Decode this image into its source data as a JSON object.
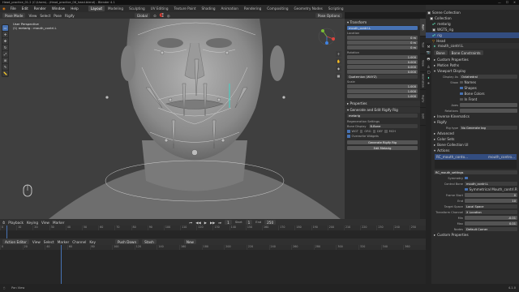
{
  "window": {
    "title": "Head_practice_01.2 (C:\\Users\\...\\Head_practice_06_head.blend) - Blender 4.1"
  },
  "menu": [
    "File",
    "Edit",
    "Render",
    "Window",
    "Help"
  ],
  "workspaces": [
    "Layout",
    "Modeling",
    "Sculpting",
    "UV Editing",
    "Texture Paint",
    "Shading",
    "Animation",
    "Rendering",
    "Compositing",
    "Geometry Nodes",
    "Scripting"
  ],
  "active_workspace": "Layout",
  "scene": {
    "scene_label": "Scene",
    "view_layer": "ViewLayer"
  },
  "header3d": {
    "mode": "Pose Mode",
    "view": "View",
    "select": "Select",
    "pose": "Pose",
    "rigify": "Rigify",
    "orientation": "Global",
    "pose_options": "Pose Options"
  },
  "viewport": {
    "view_name": "User Perspective",
    "object_name": "(1) metarig : mouth_contrl.L"
  },
  "npanel": {
    "transform_title": "Transform",
    "bone_name": "mouth_contrl.L",
    "location_label": "Location",
    "loc": [
      "0 m",
      "0 m",
      "0 m"
    ],
    "rotation_label": "Rotation",
    "rot_mode": "Quaternion (WXYZ)",
    "rot": [
      "1.000",
      "0.000",
      "0.000",
      "0.000"
    ],
    "scale_label": "Scale",
    "scale": [
      "1.000",
      "1.000",
      "1.000"
    ],
    "properties_title": "Properties",
    "gen_title": "Generate and Edit Rigify Rig",
    "metarig_field": "metarig",
    "regen_title": "Regeneration Settings",
    "bone_display": "Bone Display",
    "bone_display_val": "B-Bone",
    "wgt_opts": [
      "WGT",
      "ORG",
      "DEF",
      "MCH"
    ],
    "overwrite_widgets": "Overwrite Widgets",
    "generate_btn": "Generate Rigify Rig",
    "edit_btn": "Edit Metarig"
  },
  "vtabs": [
    "Item",
    "Tool",
    "View",
    "Animation",
    "Rigify",
    "Edit"
  ],
  "outliner": {
    "items": [
      "Scene Collection",
      "Collection",
      "metarig",
      "WGTS_rig",
      "rig",
      "Head"
    ]
  },
  "props": {
    "header": "mouth_contrl.L",
    "tabs": [
      "Bone",
      "Bone Constraints"
    ],
    "rows": [
      {
        "label": "Custom Properties"
      },
      {
        "label": "Motion Paths"
      },
      {
        "label": "Viewport Display"
      },
      {
        "label": "Display As",
        "value": "Octahedral"
      },
      {
        "label": "Show",
        "value": "Names"
      },
      {
        "label": "",
        "value": "Shapes"
      },
      {
        "label": "",
        "value": "Bone Colors"
      },
      {
        "label": "",
        "value": "In Front"
      },
      {
        "label": "Axes",
        "value": ""
      },
      {
        "label": "Relations",
        "value": ""
      },
      {
        "label": "Inverse Kinematics"
      },
      {
        "label": "Rigify"
      },
      {
        "label": "Rig type",
        "value": "No Generate tag"
      },
      {
        "label": "Advanced"
      },
      {
        "label": "Color Sets"
      },
      {
        "label": "Bone Collection UI"
      },
      {
        "label": "Actions"
      }
    ],
    "actions_list": [
      "RC_mouth_conto...",
      "mouth_contro..."
    ],
    "action_row": "RC_mouth_settings",
    "action_fields": [
      {
        "label": "Symmetry",
        "value": ""
      },
      {
        "label": "Control Bone",
        "value": "mouth_contrl.L"
      },
      {
        "label": "",
        "value": "Symmetrical Mouth_contrl.R"
      },
      {
        "label": "Frame Start",
        "value": "0"
      },
      {
        "label": "End",
        "value": "10"
      },
      {
        "label": "Target Space",
        "value": "Local Space"
      },
      {
        "label": "Transform Channel",
        "value": "X Location"
      },
      {
        "label": "Min",
        "value": "-0.01"
      },
      {
        "label": "Max",
        "value": "0.01"
      },
      {
        "label": "Nodes",
        "value": "Default Corner"
      }
    ],
    "footer": "Custom Properties"
  },
  "timeline": {
    "playback": "Playback",
    "keying": "Keying",
    "view": "View",
    "marker": "Marker",
    "frame": "1",
    "start_label": "Start",
    "start": "1",
    "end_label": "End",
    "end": "250",
    "ticks": [
      "0",
      "10",
      "20",
      "30",
      "40",
      "50",
      "60",
      "70",
      "80",
      "90",
      "100",
      "110",
      "120",
      "130",
      "140",
      "150",
      "160",
      "170",
      "180",
      "190",
      "200",
      "210",
      "220",
      "230",
      "240",
      "250"
    ]
  },
  "action_editor": {
    "mode": "Action Editor",
    "view": "View",
    "select": "Select",
    "marker": "Marker",
    "channel": "Channel",
    "key": "Key",
    "push_down": "Push Down",
    "stash": "Stash",
    "new": "New",
    "ticks": [
      "0",
      "20",
      "40",
      "60",
      "80",
      "100",
      "120",
      "140",
      "160",
      "180",
      "200",
      "220",
      "240",
      "260",
      "280",
      "300",
      "320",
      "340",
      "360"
    ]
  },
  "status": {
    "left": "Pan View",
    "right": "4.1.0"
  },
  "colors": {
    "accent": "#4772b3",
    "bone": "#b9b9b9",
    "mesh": "#8c8c8c"
  }
}
